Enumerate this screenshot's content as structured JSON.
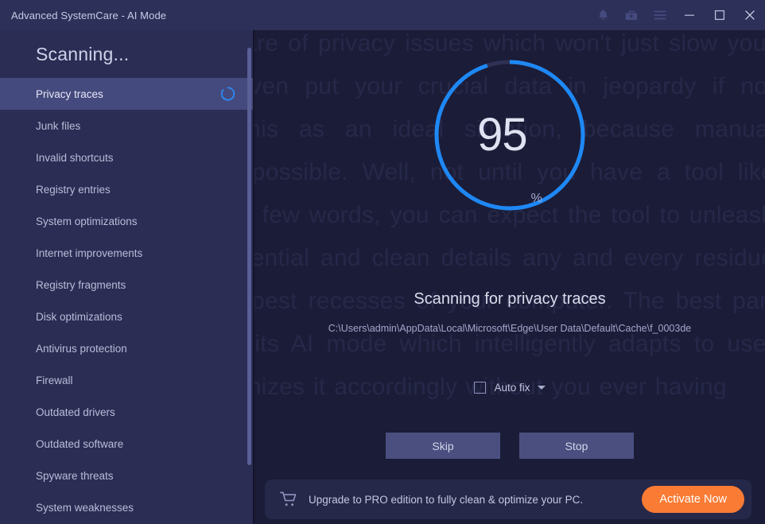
{
  "window": {
    "title": "Advanced SystemCare - AI Mode",
    "controls": [
      {
        "name": "notifications-icon",
        "label": "Notifications"
      },
      {
        "name": "toolbox-icon",
        "label": "Toolbox"
      },
      {
        "name": "menu-icon",
        "label": "Menu"
      },
      {
        "name": "minimize-icon",
        "label": "Minimize"
      },
      {
        "name": "maximize-icon",
        "label": "Maximize"
      },
      {
        "name": "close-icon",
        "label": "Close"
      }
    ]
  },
  "sidebar": {
    "title": "Scanning...",
    "items": [
      {
        "label": "Privacy traces",
        "active": true,
        "spinner": true
      },
      {
        "label": "Junk files",
        "active": false,
        "spinner": false
      },
      {
        "label": "Invalid shortcuts",
        "active": false,
        "spinner": false
      },
      {
        "label": "Registry entries",
        "active": false,
        "spinner": false
      },
      {
        "label": "System optimizations",
        "active": false,
        "spinner": false
      },
      {
        "label": "Internet improvements",
        "active": false,
        "spinner": false
      },
      {
        "label": "Registry fragments",
        "active": false,
        "spinner": false
      },
      {
        "label": "Disk optimizations",
        "active": false,
        "spinner": false
      },
      {
        "label": "Antivirus protection",
        "active": false,
        "spinner": false
      },
      {
        "label": "Firewall",
        "active": false,
        "spinner": false
      },
      {
        "label": "Outdated drivers",
        "active": false,
        "spinner": false
      },
      {
        "label": "Outdated software",
        "active": false,
        "spinner": false
      },
      {
        "label": "Spyware threats",
        "active": false,
        "spinner": false
      },
      {
        "label": "System weaknesses",
        "active": false,
        "spinner": false
      }
    ]
  },
  "main": {
    "progress": {
      "value": "95",
      "unit": "%",
      "percent": 95,
      "ring_color": "#1e88f5",
      "track_color": "#2e3154"
    },
    "scan_heading": "Scanning for privacy traces",
    "scan_path": "C:\\Users\\admin\\AppData\\Local\\Microsoft\\Edge\\User Data\\Default\\Cache\\f_0003de",
    "auto_fix": {
      "label": "Auto fix",
      "checked": false
    },
    "buttons": {
      "skip": "Skip",
      "stop": "Stop"
    }
  },
  "banner": {
    "text": "Upgrade to PRO edition to fully clean & optimize your PC.",
    "cta": "Activate Now",
    "cta_color": "#f97b34"
  },
  "background": {
    "ghost_text": "time and even takes care of privacy issues which won't just slow your computer down but even put your crucial data in jeopardy if not looking. Addressing this as an ideal situation, because manual cleaning is next to impossible. Well, not until you have a tool like SystemCare. If put in a few words, you can expect the tool to unleash your slow PC's full potential and clean details any and every residue that resides in the deepest recesses of your computer. The best part about this software is its AI mode which intelligently adapts to user behavior and then optimizes it accordingly without you ever having"
  }
}
